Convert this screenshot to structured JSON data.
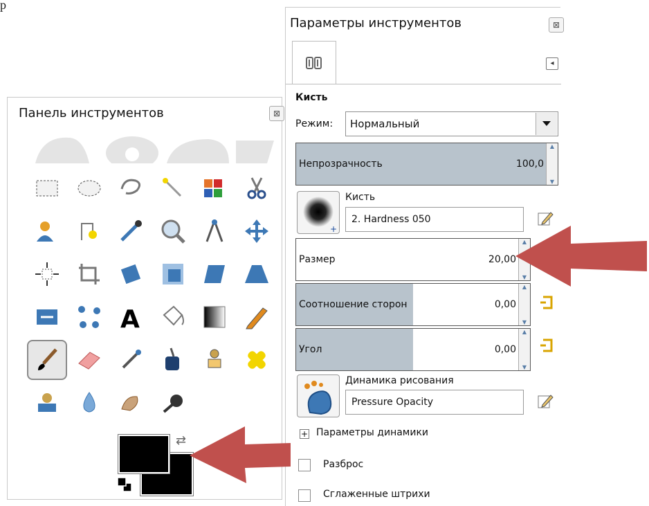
{
  "page": {
    "top_text": "р"
  },
  "toolbox": {
    "title": "Панель инструментов",
    "close_glyph": "⊠",
    "tools": [
      "rect-select-icon",
      "ellipse-select-icon",
      "free-select-icon",
      "fuzzy-select-icon",
      "color-select-icon",
      "scissors-select-icon",
      "foreground-select-icon",
      "paths-icon",
      "color-picker-icon",
      "zoom-icon",
      "measure-icon",
      "move-icon",
      "align-icon",
      "crop-icon",
      "rotate-icon",
      "scale-icon",
      "shear-icon",
      "perspective-icon",
      "flip-icon",
      "cage-transform-icon",
      "text-icon",
      "bucket-fill-icon",
      "blend-icon",
      "pencil-icon",
      "paintbrush-icon",
      "eraser-icon",
      "airbrush-icon",
      "ink-icon",
      "clone-icon",
      "heal-icon",
      "perspective-clone-icon",
      "blur-sharpen-icon",
      "smudge-icon",
      "dodge-burn-icon"
    ],
    "active_tool": "paintbrush-icon",
    "fg_color": "#000000",
    "bg_color": "#000000"
  },
  "options": {
    "title": "Параметры инструментов",
    "close_glyph": "⊠",
    "tab_arrow": "◂",
    "section": "Кисть",
    "mode_label": "Режим:",
    "mode_value": "Нормальный",
    "opacity": {
      "label": "Непрозрачность",
      "value": "100,0",
      "fraction": 1.0
    },
    "brush_label": "Кисть",
    "brush_value": "2. Hardness 050",
    "size": {
      "label": "Размер",
      "value": "20,00",
      "fraction": 0.0
    },
    "aspect": {
      "label": "Соотношение сторон",
      "value": "0,00",
      "fraction": 0.5
    },
    "angle": {
      "label": "Угол",
      "value": "0,00",
      "fraction": 0.5
    },
    "dynamics_label": "Динамика рисования",
    "dynamics_value": "Pressure Opacity",
    "dynamics_options_label": "Параметры динамики",
    "expander_glyph": "+",
    "jitter_label": "Разброс",
    "smooth_label": "Сглаженные штрихи"
  },
  "colors": {
    "arrow": "#c0504d",
    "slider_fill": "#b8c3cc"
  }
}
